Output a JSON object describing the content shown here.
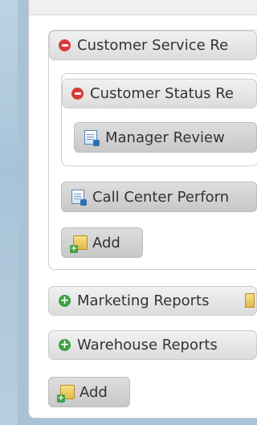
{
  "sections": {
    "customer_service": {
      "label": "Customer Service Re",
      "expanded": true
    },
    "customer_status": {
      "label": "Customer Status Re",
      "expanded": true
    },
    "marketing": {
      "label": "Marketing Reports",
      "expanded": false
    },
    "warehouse": {
      "label": "Warehouse Reports",
      "expanded": false
    }
  },
  "reports": {
    "manager_review": "Manager Review",
    "call_center": "Call Center Perforn"
  },
  "add_buttons": {
    "inner_add": "Add",
    "outer_add": "Add"
  },
  "icons": {
    "collapse": "minus-circle-icon",
    "expand": "plus-circle-icon",
    "report": "report-document-icon",
    "add": "add-folder-icon"
  },
  "colors": {
    "collapse_red": "#d83a3a",
    "expand_green": "#3ea042"
  }
}
